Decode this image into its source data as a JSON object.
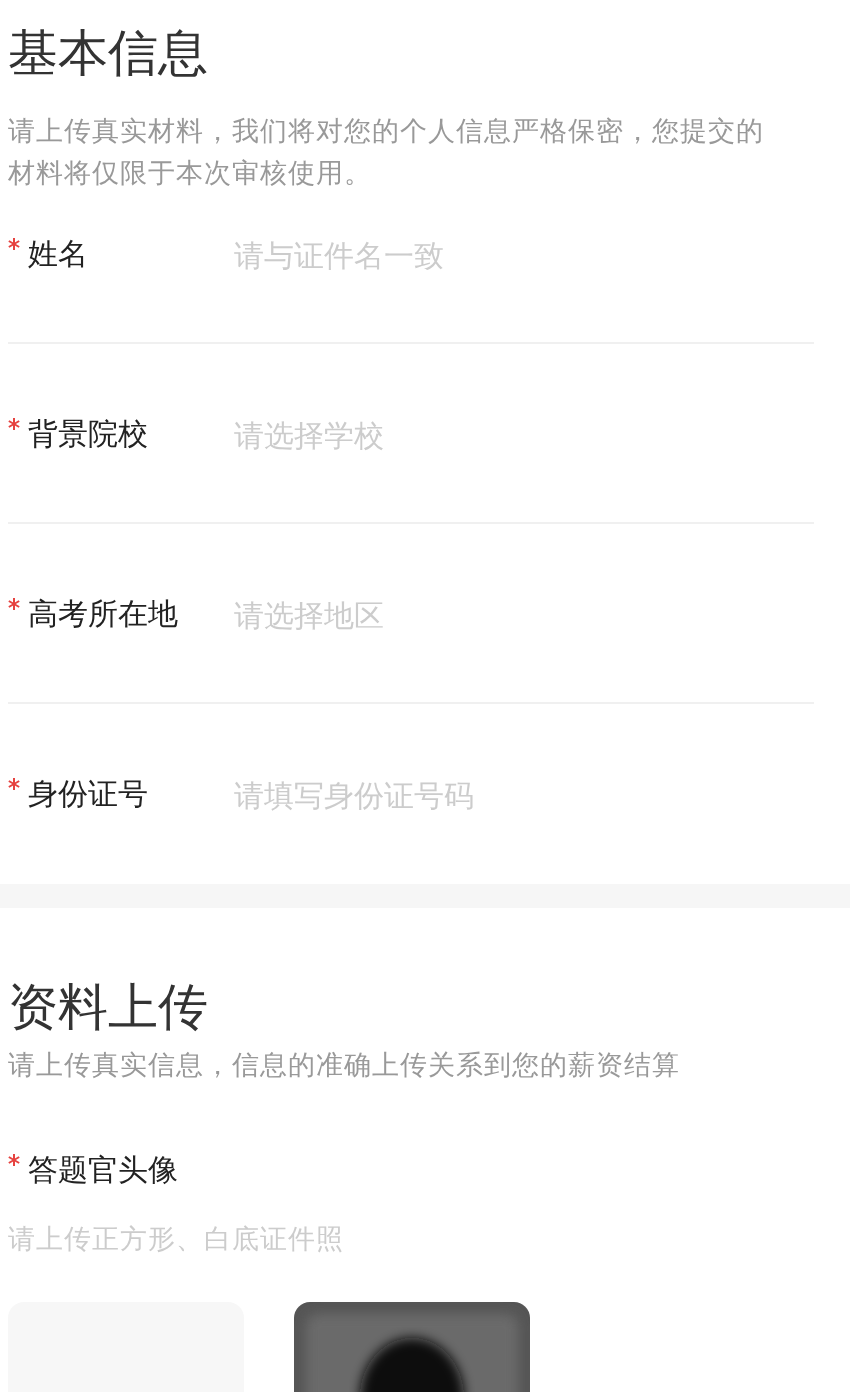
{
  "basic_info": {
    "title": "基本信息",
    "description": "请上传真实材料，我们将对您的个人信息严格保密，您提交的材料将仅限于本次审核使用。",
    "fields": [
      {
        "label": "姓名",
        "required": true,
        "placeholder": "请与证件名一致"
      },
      {
        "label": "背景院校",
        "required": true,
        "placeholder": "请选择学校"
      },
      {
        "label": "高考所在地",
        "required": true,
        "placeholder": "请选择地区"
      },
      {
        "label": "身份证号",
        "required": true,
        "placeholder": "请填写身份证号码"
      }
    ]
  },
  "upload": {
    "title": "资料上传",
    "description": "请上传真实信息，信息的准确上传关系到您的薪资结算",
    "avatar": {
      "label": "答题官头像",
      "required": true,
      "hint": "请上传正方形、白底证件照",
      "tiles": [
        {
          "kind": "empty"
        },
        {
          "kind": "picture"
        }
      ]
    }
  }
}
